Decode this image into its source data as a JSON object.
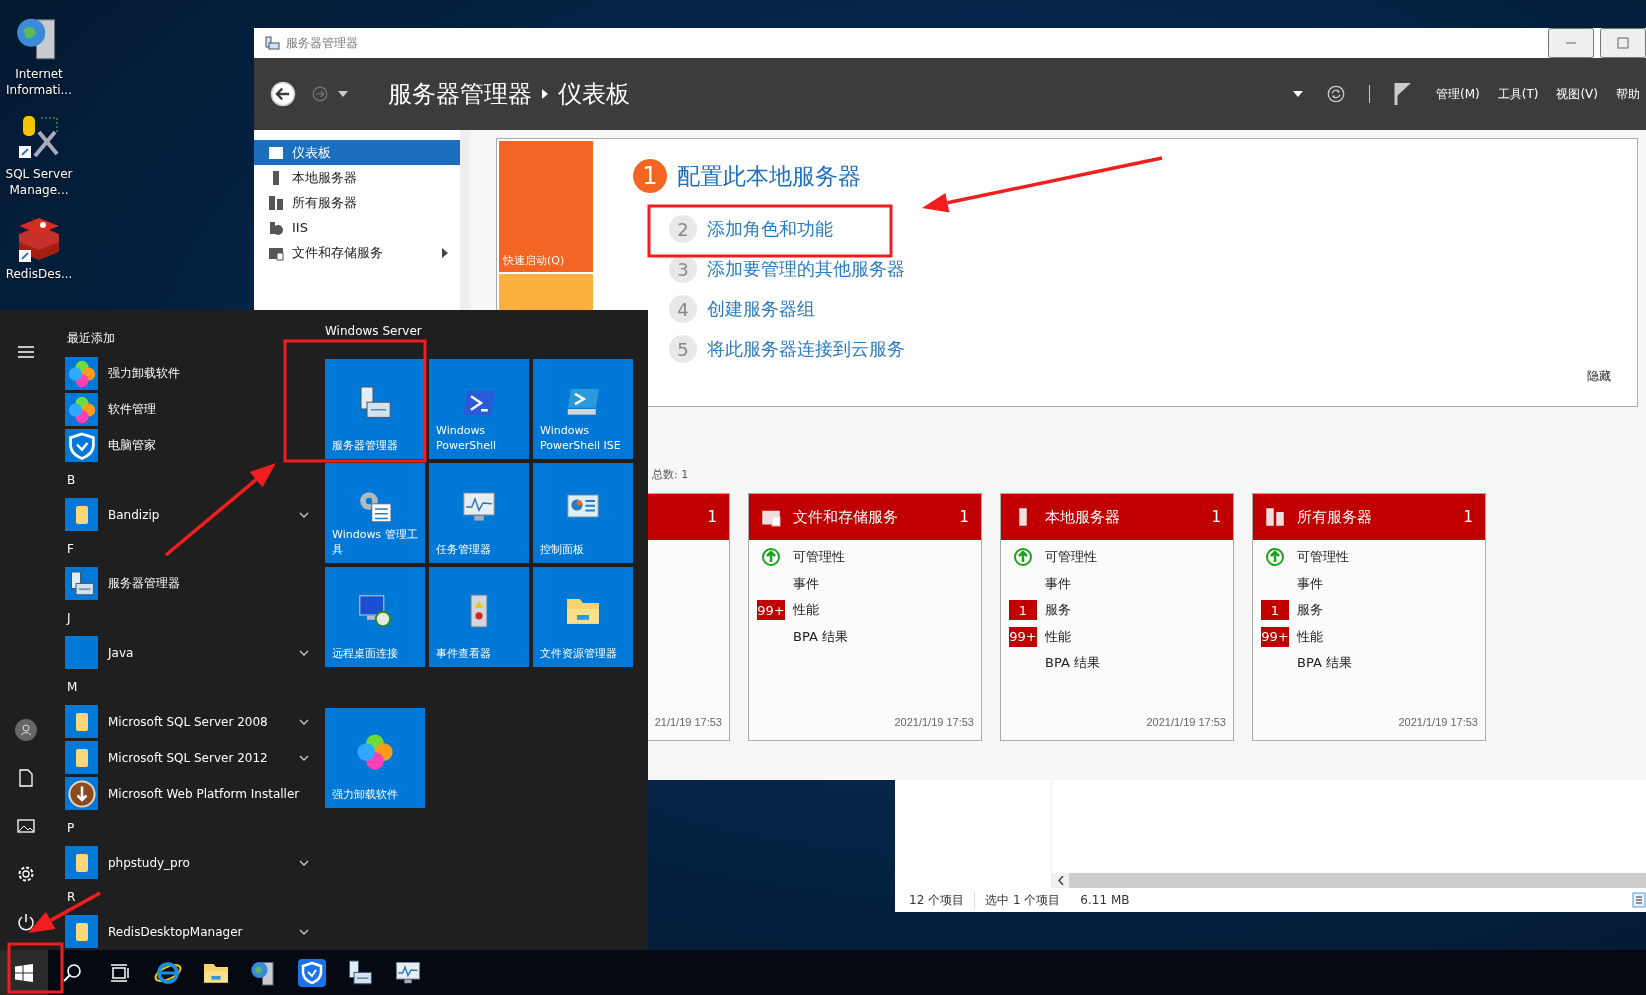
{
  "desktop_icons": [
    {
      "label": "Internet Informati...",
      "kind": "iis"
    },
    {
      "label": "SQL Server Manage...",
      "kind": "sql"
    },
    {
      "label": "RedisDes...",
      "kind": "redis"
    }
  ],
  "server_manager": {
    "title": "服务器管理器",
    "breadcrumb": [
      "服务器管理器",
      "仪表板"
    ],
    "menu": [
      "管理(M)",
      "工具(T)",
      "视图(V)",
      "帮助"
    ],
    "nav": [
      {
        "label": "仪表板",
        "kind": "dashboard",
        "selected": true,
        "expandable": false
      },
      {
        "label": "本地服务器",
        "kind": "server",
        "selected": false,
        "expandable": false
      },
      {
        "label": "所有服务器",
        "kind": "servers",
        "selected": false,
        "expandable": false
      },
      {
        "label": "IIS",
        "kind": "iis",
        "selected": false,
        "expandable": false
      },
      {
        "label": "文件和存储服务",
        "kind": "files",
        "selected": false,
        "expandable": true
      }
    ],
    "quick_start": {
      "tiles": [
        {
          "label": "快速启动(Q)",
          "color": "#f26522"
        },
        {
          "color": "#fbb040"
        }
      ],
      "heading_number": "1",
      "heading": "配置此本地服务器",
      "steps": [
        {
          "number": "2",
          "label": "添加角色和功能"
        },
        {
          "number": "3",
          "label": "添加要管理的其他服务器"
        },
        {
          "number": "4",
          "label": "创建服务器组"
        },
        {
          "number": "5",
          "label": "将此服务器连接到云服务"
        }
      ],
      "hide": "隐藏"
    },
    "summary": "总数: 1",
    "cards": [
      {
        "count": "1",
        "date": "21/1/19 17:53"
      },
      {
        "title": "文件和存储服务",
        "kind": "files",
        "count": "1",
        "date": "2021/1/19 17:53",
        "rows": [
          {
            "kind": "ok",
            "label": "可管理性"
          },
          {
            "kind": "plain",
            "label": "事件"
          },
          {
            "kind": "badge",
            "badge": "99+",
            "label": "性能"
          },
          {
            "kind": "plain",
            "label": "BPA 结果"
          }
        ]
      },
      {
        "title": "本地服务器",
        "kind": "server",
        "count": "1",
        "date": "2021/1/19 17:53",
        "rows": [
          {
            "kind": "ok",
            "label": "可管理性"
          },
          {
            "kind": "plain",
            "label": "事件"
          },
          {
            "kind": "badge",
            "badge": "1",
            "label": "服务"
          },
          {
            "kind": "badge",
            "badge": "99+",
            "label": "性能"
          },
          {
            "kind": "plain",
            "label": "BPA 结果"
          }
        ]
      },
      {
        "title": "所有服务器",
        "kind": "servers",
        "count": "1",
        "date": "2021/1/19 17:53",
        "rows": [
          {
            "kind": "ok",
            "label": "可管理性"
          },
          {
            "kind": "plain",
            "label": "事件"
          },
          {
            "kind": "badge",
            "badge": "1",
            "label": "服务"
          },
          {
            "kind": "badge",
            "badge": "99+",
            "label": "性能"
          },
          {
            "kind": "plain",
            "label": "BPA 结果"
          }
        ]
      }
    ]
  },
  "explorer": {
    "status": [
      "12 个项目",
      "选中 1 个项目",
      "6.11 MB"
    ]
  },
  "start_menu": {
    "groups": [
      {
        "heading": "最近添加",
        "apps": [
          {
            "label": "强力卸载软件",
            "kind": "clover",
            "expandable": false
          },
          {
            "label": "软件管理",
            "kind": "clover",
            "expandable": false
          },
          {
            "label": "电脑管家",
            "kind": "shield",
            "expandable": false
          }
        ]
      },
      {
        "heading": "B",
        "apps": [
          {
            "label": "Bandizip",
            "kind": "folder",
            "expandable": true
          }
        ]
      },
      {
        "heading": "F",
        "apps": [
          {
            "label": "服务器管理器",
            "kind": "server",
            "expandable": false
          }
        ]
      },
      {
        "heading": "J",
        "apps": [
          {
            "label": "Java",
            "kind": "blank",
            "expandable": true
          }
        ]
      },
      {
        "heading": "M",
        "apps": [
          {
            "label": "Microsoft SQL Server 2008",
            "kind": "folder",
            "expandable": true
          },
          {
            "label": "Microsoft SQL Server 2012",
            "kind": "folder",
            "expandable": true
          },
          {
            "label": "Microsoft Web Platform Installer",
            "kind": "installer",
            "expandable": false
          }
        ]
      },
      {
        "heading": "P",
        "apps": [
          {
            "label": "phpstudy_pro",
            "kind": "folder",
            "expandable": true
          }
        ]
      },
      {
        "heading": "R",
        "apps": [
          {
            "label": "RedisDesktopManager",
            "kind": "folder",
            "expandable": true
          }
        ]
      }
    ],
    "tile_group": "Windows Server",
    "tiles": [
      {
        "label": "服务器管理器",
        "kind": "server"
      },
      {
        "label": "Windows PowerShell",
        "kind": "powershell"
      },
      {
        "label": "Windows PowerShell ISE",
        "kind": "ise"
      },
      {
        "label": "Windows 管理工具",
        "kind": "admin"
      },
      {
        "label": "任务管理器",
        "kind": "taskmgr"
      },
      {
        "label": "控制面板",
        "kind": "control"
      },
      {
        "label": "远程桌面连接",
        "kind": "remote"
      },
      {
        "label": "事件查看器",
        "kind": "events"
      },
      {
        "label": "文件资源管理器",
        "kind": "explorer"
      }
    ],
    "extra_tiles": [
      {
        "label": "强力卸载软件",
        "kind": "clover"
      }
    ]
  },
  "taskbar": [
    {
      "kind": "start",
      "selected": true
    },
    {
      "kind": "search",
      "selected": false
    },
    {
      "kind": "taskview",
      "selected": false
    },
    {
      "kind": "ie",
      "selected": false
    },
    {
      "kind": "explorer",
      "selected": false
    },
    {
      "kind": "iis",
      "selected": false
    },
    {
      "kind": "shield",
      "selected": false
    },
    {
      "kind": "server",
      "selected": false
    },
    {
      "kind": "taskmgr",
      "selected": false
    }
  ]
}
